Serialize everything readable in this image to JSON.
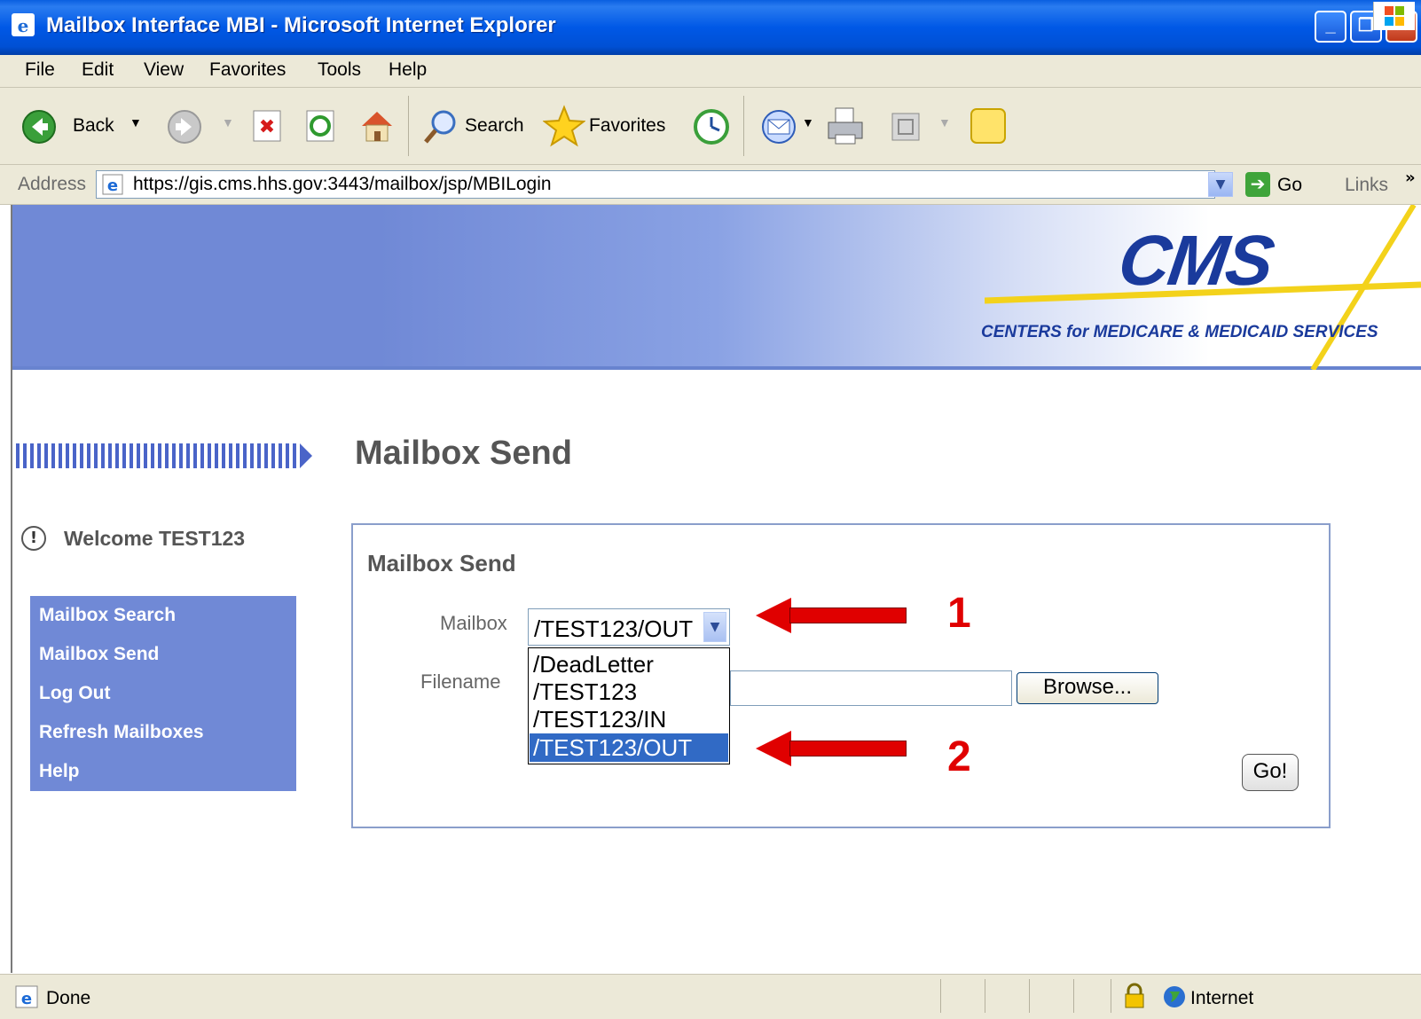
{
  "window": {
    "title": "Mailbox Interface MBI - Microsoft Internet Explorer"
  },
  "menu": [
    "File",
    "Edit",
    "View",
    "Favorites",
    "Tools",
    "Help"
  ],
  "toolbar": {
    "back_label": "Back",
    "search_label": "Search",
    "favorites_label": "Favorites"
  },
  "address": {
    "label": "Address",
    "url": "https://gis.cms.hhs.gov:3443/mailbox/jsp/MBILogin",
    "go_label": "Go",
    "links_label": "Links"
  },
  "banner": {
    "logo_text": "CMS",
    "logo_subtitle": "CENTERS for MEDICARE & MEDICAID SERVICES"
  },
  "page": {
    "title": "Mailbox Send",
    "welcome": "Welcome TEST123",
    "nav": [
      "Mailbox Search",
      "Mailbox Send",
      "Log Out",
      "Refresh Mailboxes",
      "Help"
    ],
    "form": {
      "heading": "Mailbox Send",
      "mailbox_label": "Mailbox",
      "mailbox_selected": "/TEST123/OUT",
      "mailbox_options": [
        "/DeadLetter",
        "/TEST123",
        "/TEST123/IN",
        "/TEST123/OUT"
      ],
      "filename_label": "Filename",
      "filename_value": "",
      "browse_label": "Browse...",
      "go_label": "Go!"
    }
  },
  "annotations": {
    "callout_1": "1",
    "callout_2": "2"
  },
  "status": {
    "text": "Done",
    "zone": "Internet"
  },
  "colors": {
    "titlebar": "#0058e6",
    "nav_bg": "#7089d6",
    "arrow": "#e00000",
    "selection": "#316ac5"
  }
}
